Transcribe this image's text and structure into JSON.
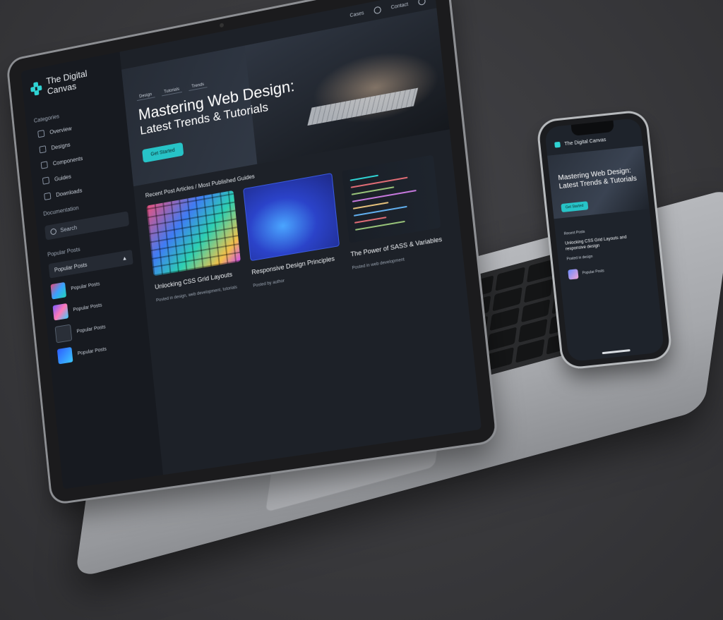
{
  "site": {
    "name": "The Digital Canvas"
  },
  "sidebar": {
    "categories_heading": "Categories",
    "items": [
      {
        "label": "Overview",
        "icon": "home-icon"
      },
      {
        "label": "Designs",
        "icon": "grid-icon"
      },
      {
        "label": "Components",
        "icon": "layout-icon"
      },
      {
        "label": "Guides",
        "icon": "book-icon"
      },
      {
        "label": "Downloads",
        "icon": "download-icon"
      }
    ],
    "extra_heading": "Documentation",
    "search_placeholder": "Search",
    "popular_heading": "Popular Posts",
    "popular_dropdown": "Popular Posts",
    "popular_items": [
      {
        "label": "Popular Posts"
      },
      {
        "label": "Popular Posts"
      },
      {
        "label": "Popular Posts"
      },
      {
        "label": "Popular Posts"
      }
    ]
  },
  "topbar": {
    "link_one": "Cases",
    "link_two": "Contact"
  },
  "hero": {
    "tags": [
      "Design",
      "Tutorials",
      "Trends"
    ],
    "title_line1": "Mastering Web Design:",
    "title_line2": "Latest Trends & Tutorials",
    "button": "Get Started"
  },
  "recent": {
    "heading": "Recent Post Articles / Most Published Guides",
    "cards": [
      {
        "title": "Unlocking CSS Grid Layouts",
        "meta": "Posted in design, web development, tutorials"
      },
      {
        "title": "Responsive Design Principles",
        "meta": "Posted by author"
      },
      {
        "title": "The Power of SASS & Variables",
        "meta": "Posted in web development"
      }
    ]
  },
  "phone": {
    "brand": "The Digital Canvas",
    "hero_title_line1": "Mastering Web Design:",
    "hero_title_line2": "Latest Trends & Tutorials",
    "hero_button": "Get Started",
    "section_label": "Recent Posts",
    "post_title": "Unlocking CSS Grid Layouts and responsive design",
    "post_meta": "Posted in design",
    "author_name": "Popular Posts"
  },
  "colors": {
    "accent": "#27c3c7",
    "background": "#3b3b3e",
    "screen": "#1d2128"
  }
}
